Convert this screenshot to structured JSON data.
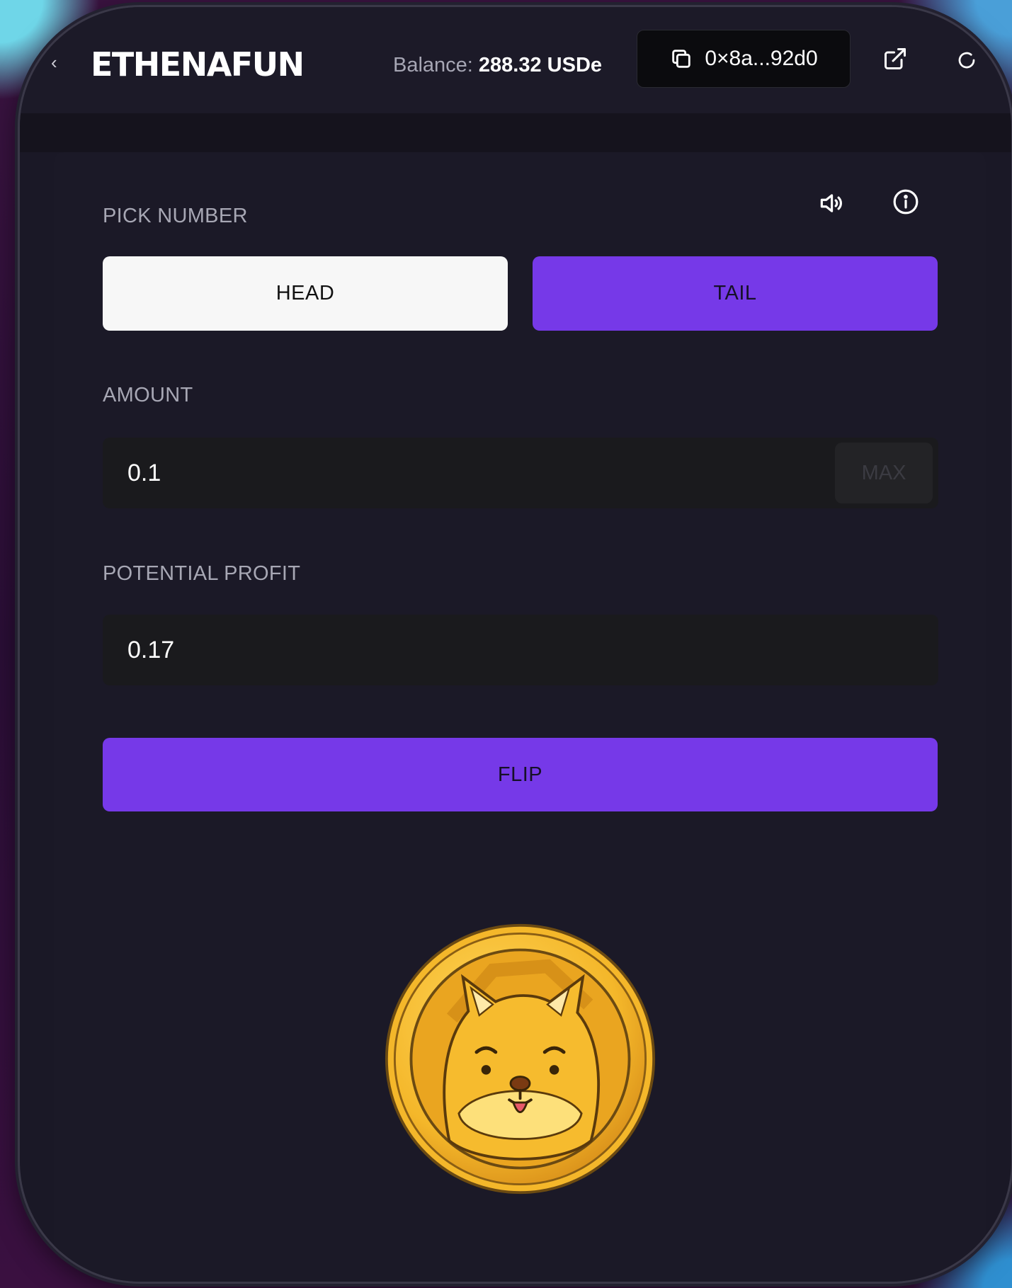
{
  "header": {
    "brand": "ETHENAFUN",
    "balance_label": "Balance:",
    "balance_value": "288.32 USDe",
    "wallet_address": "0×8a...92d0"
  },
  "game": {
    "pick_label": "PICK NUMBER",
    "options": [
      {
        "label": "HEAD",
        "selected": false
      },
      {
        "label": "TAIL",
        "selected": true
      }
    ],
    "amount_label": "AMOUNT",
    "amount_value": "0.1",
    "max_label": "MAX",
    "profit_label": "POTENTIAL PROFIT",
    "profit_value": "0.17",
    "flip_label": "FLIP"
  },
  "icons": [
    "chevron-left-icon",
    "copy-icon",
    "external-link-icon",
    "refresh-icon",
    "volume-icon",
    "info-icon",
    "coin-image"
  ],
  "colors": {
    "accent": "#7639e8",
    "background": "#1b1927",
    "field": "#1a1a1d",
    "coin_gold": "#f4b72a"
  }
}
